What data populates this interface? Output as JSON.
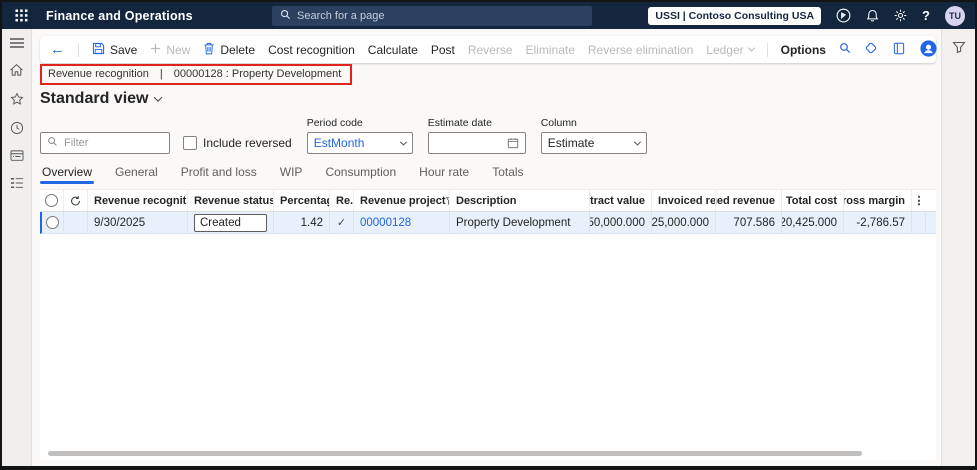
{
  "colors": {
    "accent": "#2266e3",
    "topbar_bg": "#14263e",
    "selected_row_bg": "#e8f1fb",
    "highlight_border": "#df251b"
  },
  "topbar": {
    "app_title": "Finance and Operations",
    "search_placeholder": "Search for a page",
    "environment": "USSI | Contoso Consulting USA",
    "help_label": "?",
    "avatar_initials": "TU"
  },
  "action_pane": {
    "save": "Save",
    "new": "New",
    "delete": "Delete",
    "cost_recognition": "Cost recognition",
    "calculate": "Calculate",
    "post": "Post",
    "reverse": "Reverse",
    "eliminate": "Eliminate",
    "reverse_elimination": "Reverse elimination",
    "ledger": "Ledger",
    "options": "Options"
  },
  "breadcrumb": {
    "section": "Revenue recognition",
    "separator": "|",
    "record": "00000128 : Property Development"
  },
  "view": {
    "title": "Standard view"
  },
  "filters": {
    "filter_placeholder": "Filter",
    "include_reversed_label": "Include reversed",
    "period_code_label": "Period code",
    "period_code_value": "EstMonth",
    "estimate_date_label": "Estimate date",
    "estimate_date_value": "",
    "column_label": "Column",
    "column_value": "Estimate"
  },
  "tabs": [
    "Overview",
    "General",
    "Profit and loss",
    "WIP",
    "Consumption",
    "Hour rate",
    "Totals"
  ],
  "grid": {
    "columns": [
      "Revenue recognition ...",
      "Revenue status",
      "Percentage co...",
      "Re...",
      "Revenue project",
      "Description",
      "Contract value",
      "Invoiced reven...",
      "Accrued revenue",
      "Total cost",
      "Gross margin"
    ],
    "more_glyph": "⋮",
    "rows": [
      {
        "date": "9/30/2025",
        "status": "Created",
        "percentage_completed": "1.42",
        "reversed_check": "✓",
        "project": "00000128",
        "description": "Property Development",
        "contract_value": "50,000.000",
        "invoiced_revenue": "25,000.000",
        "accrued_revenue": "707.586",
        "total_cost": "20,425.000",
        "gross_margin": "-2,786.57"
      }
    ]
  }
}
